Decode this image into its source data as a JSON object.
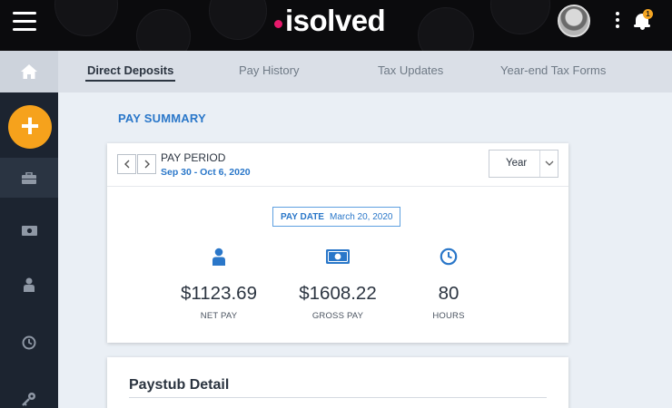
{
  "header": {
    "logo_text": "isolved",
    "notification_count": "1"
  },
  "tabs": [
    {
      "label": "Direct Deposits",
      "active": true
    },
    {
      "label": "Pay History",
      "active": false
    },
    {
      "label": "Tax Updates",
      "active": false
    },
    {
      "label": "Year-end Tax Forms",
      "active": false
    }
  ],
  "sidebar": {
    "fab_label": "+",
    "items": [
      {
        "icon": "briefcase-icon"
      },
      {
        "icon": "money-icon"
      },
      {
        "icon": "person-icon"
      },
      {
        "icon": "clock-icon"
      },
      {
        "icon": "key-icon"
      }
    ]
  },
  "pay_summary": {
    "title": "PAY SUMMARY",
    "period_label": "PAY PERIOD",
    "period_range": "Sep 30 - Oct 6, 2020",
    "period_select": "Year",
    "pay_date_label": "PAY DATE",
    "pay_date_value": "March 20, 2020",
    "stats": [
      {
        "icon": "person-icon",
        "value": "$1123.69",
        "label": "NET PAY"
      },
      {
        "icon": "money-icon",
        "value": "$1608.22",
        "label": "GROSS PAY"
      },
      {
        "icon": "clock-icon",
        "value": "80",
        "label": "HOURS"
      }
    ]
  },
  "paystub": {
    "title": "Paystub Detail"
  },
  "colors": {
    "accent_blue": "#2a77c9",
    "fab_orange": "#f6a21c",
    "brand_pink": "#e6196b",
    "sidebar_bg": "#1c2430"
  }
}
